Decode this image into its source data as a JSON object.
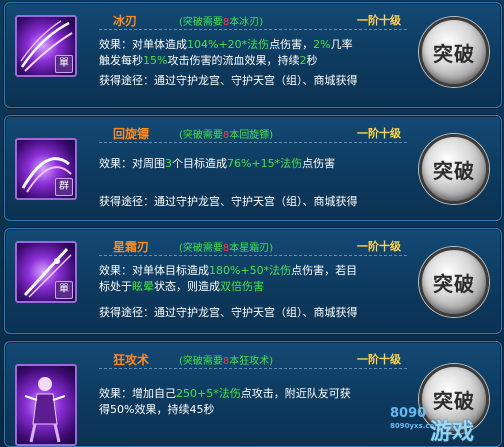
{
  "skills": [
    {
      "name": "冰刃",
      "req_prefix": "(突破需要",
      "req_num": "8",
      "req_suffix": "本冰刃)",
      "rank": "一阶十级",
      "tag": "單",
      "effect_line1": [
        {
          "t": "效果：对单体造成",
          "c": "white"
        },
        {
          "t": "104%+20*法伤",
          "c": "green"
        },
        {
          "t": "点伤害，",
          "c": "white"
        },
        {
          "t": "2%",
          "c": "green"
        },
        {
          "t": "几率",
          "c": "white"
        }
      ],
      "effect_line2": [
        {
          "t": "触发每秒",
          "c": "white"
        },
        {
          "t": "15%",
          "c": "green"
        },
        {
          "t": "攻击伤害的流血效果，持续",
          "c": "white"
        },
        {
          "t": "2",
          "c": "green"
        },
        {
          "t": "秒",
          "c": "white"
        }
      ],
      "obtain": "获得途径：通过守护龙宫、守护天宫（组）、商城获得",
      "button": "突破"
    },
    {
      "name": "回旋镖",
      "req_prefix": "(突破需要",
      "req_num": "8",
      "req_suffix": "本回旋镖)",
      "rank": "一阶十级",
      "tag": "群",
      "effect_line1": [
        {
          "t": "效果：对周围",
          "c": "white"
        },
        {
          "t": "3",
          "c": "green"
        },
        {
          "t": "个目标造成",
          "c": "white"
        },
        {
          "t": "76%+15*法伤",
          "c": "green"
        },
        {
          "t": "点伤害",
          "c": "white"
        }
      ],
      "effect_line2": [],
      "obtain": "获得途径：通过守护龙宫、守护天宫（组）、商城获得",
      "button": "突破"
    },
    {
      "name": "星霜刃",
      "req_prefix": "(突破需要",
      "req_num": "8",
      "req_suffix": "本星霜刃)",
      "rank": "一阶十级",
      "tag": "單",
      "effect_line1": [
        {
          "t": "效果：对单体目标造成",
          "c": "white"
        },
        {
          "t": "180%+50*法伤",
          "c": "green"
        },
        {
          "t": "点伤害，若目",
          "c": "white"
        }
      ],
      "effect_line2": [
        {
          "t": "标处于",
          "c": "white"
        },
        {
          "t": "眩晕",
          "c": "green"
        },
        {
          "t": "状态，则造成",
          "c": "white"
        },
        {
          "t": "双倍伤害",
          "c": "green"
        }
      ],
      "obtain": "获得途径：通过守护龙宫、守护天宫（组）、商城获得",
      "button": "突破"
    },
    {
      "name": "狂攻术",
      "req_prefix": "(突破需要",
      "req_num": "8",
      "req_suffix": "本狂攻术)",
      "rank": "一阶十级",
      "tag": "",
      "effect_line1": [
        {
          "t": "效果：增加自己",
          "c": "white"
        },
        {
          "t": "250+5*法伤",
          "c": "green"
        },
        {
          "t": "点攻击，附近队友可获",
          "c": "white"
        }
      ],
      "effect_line2": [
        {
          "t": "得50%效果，持续45秒",
          "c": "white"
        }
      ],
      "obtain": "获得途径：通过守护龙宫、守护天宫（组）、商城获得",
      "button": "突破"
    }
  ],
  "watermark": {
    "num": "8090",
    "cn": "游戏",
    "url": "8090yxs.com"
  }
}
